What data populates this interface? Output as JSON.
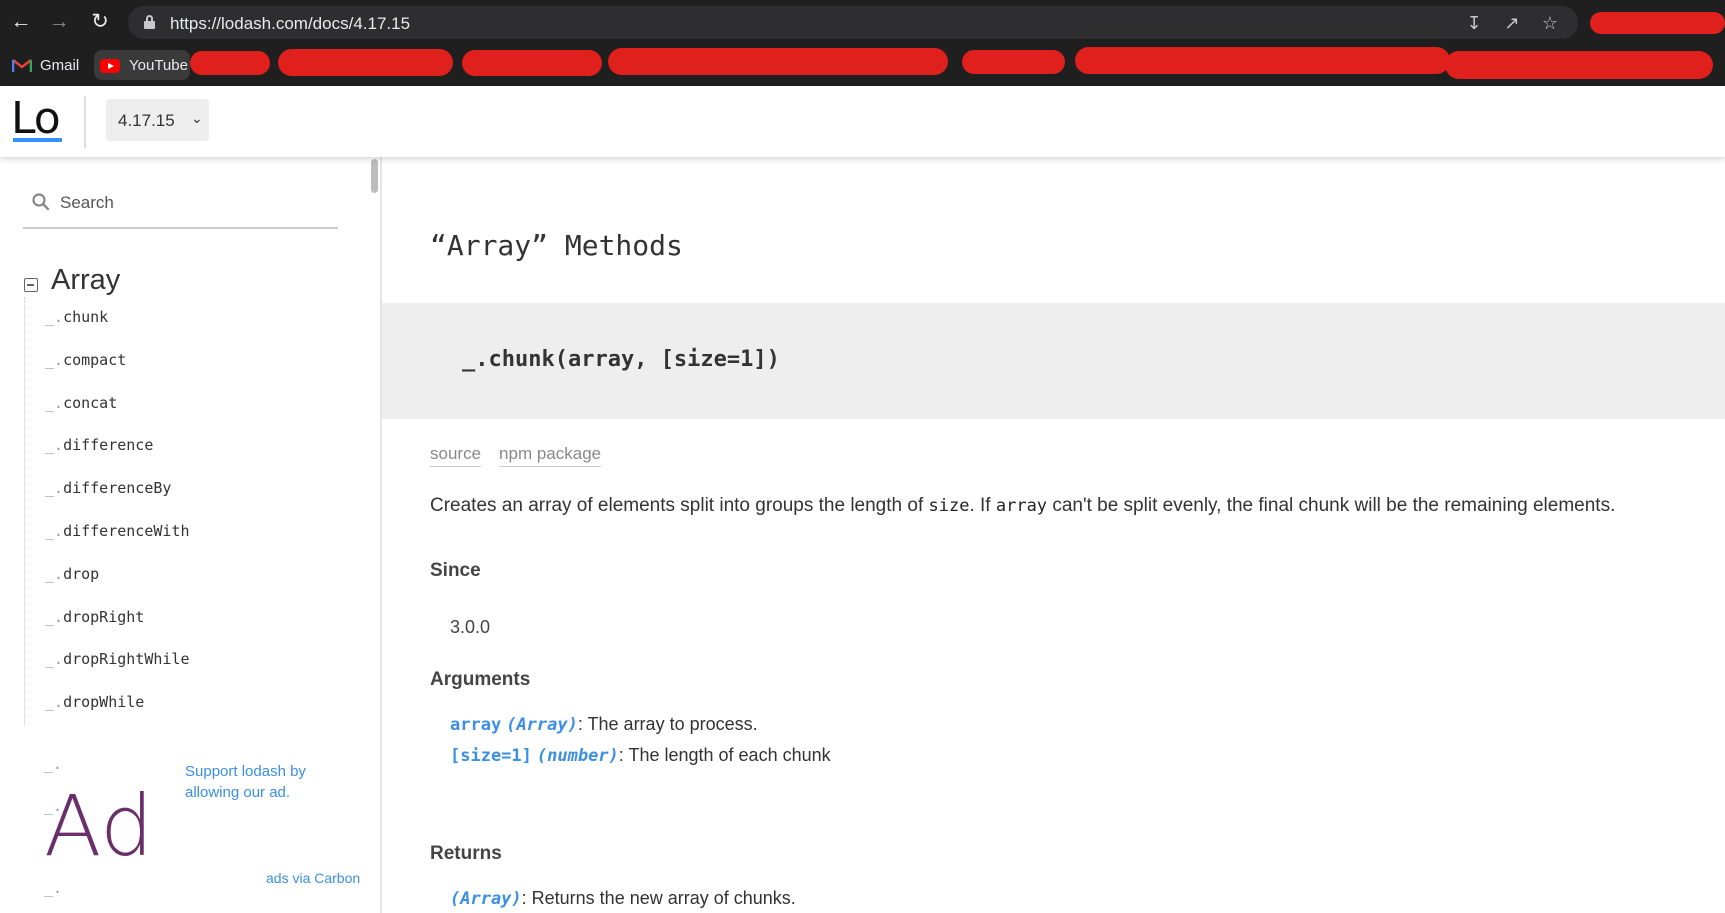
{
  "browser": {
    "url": "https://lodash.com/docs/4.17.15",
    "bookmarks": [
      {
        "label": "Gmail"
      },
      {
        "label": "YouTube"
      }
    ]
  },
  "header": {
    "logo_text": "Lo",
    "version": "4.17.15"
  },
  "sidebar": {
    "search_placeholder": "Search",
    "category": "Array",
    "methods": [
      "chunk",
      "compact",
      "concat",
      "difference",
      "differenceBy",
      "differenceWith",
      "drop",
      "dropRight",
      "dropRightWhile",
      "dropWhile"
    ],
    "method_prefix": "_.",
    "ad": {
      "big_text": "Ad",
      "text": "Support lodash by allowing our ad.",
      "via": "ads via Carbon"
    }
  },
  "main": {
    "section_title": "“Array” Methods",
    "signature": "_.chunk(array, [size=1])",
    "links": {
      "source": "source",
      "npm": "npm package"
    },
    "description": {
      "part1": "Creates an array of elements split into groups the length of ",
      "code1": "size",
      "part2": ". If ",
      "code2": "array",
      "part3": " can't be split evenly, the final chunk will be the remaining elements."
    },
    "since_heading": "Since",
    "since_value": "3.0.0",
    "arguments_heading": "Arguments",
    "arguments": [
      {
        "name": "array",
        "type": "(Array)",
        "desc": ": The array to process."
      },
      {
        "name": "[size=1]",
        "type": "(number)",
        "desc": ": The length of each chunk"
      }
    ],
    "returns_heading": "Returns",
    "returns": {
      "type": "(Array)",
      "desc": ": Returns the new array of chunks."
    }
  }
}
